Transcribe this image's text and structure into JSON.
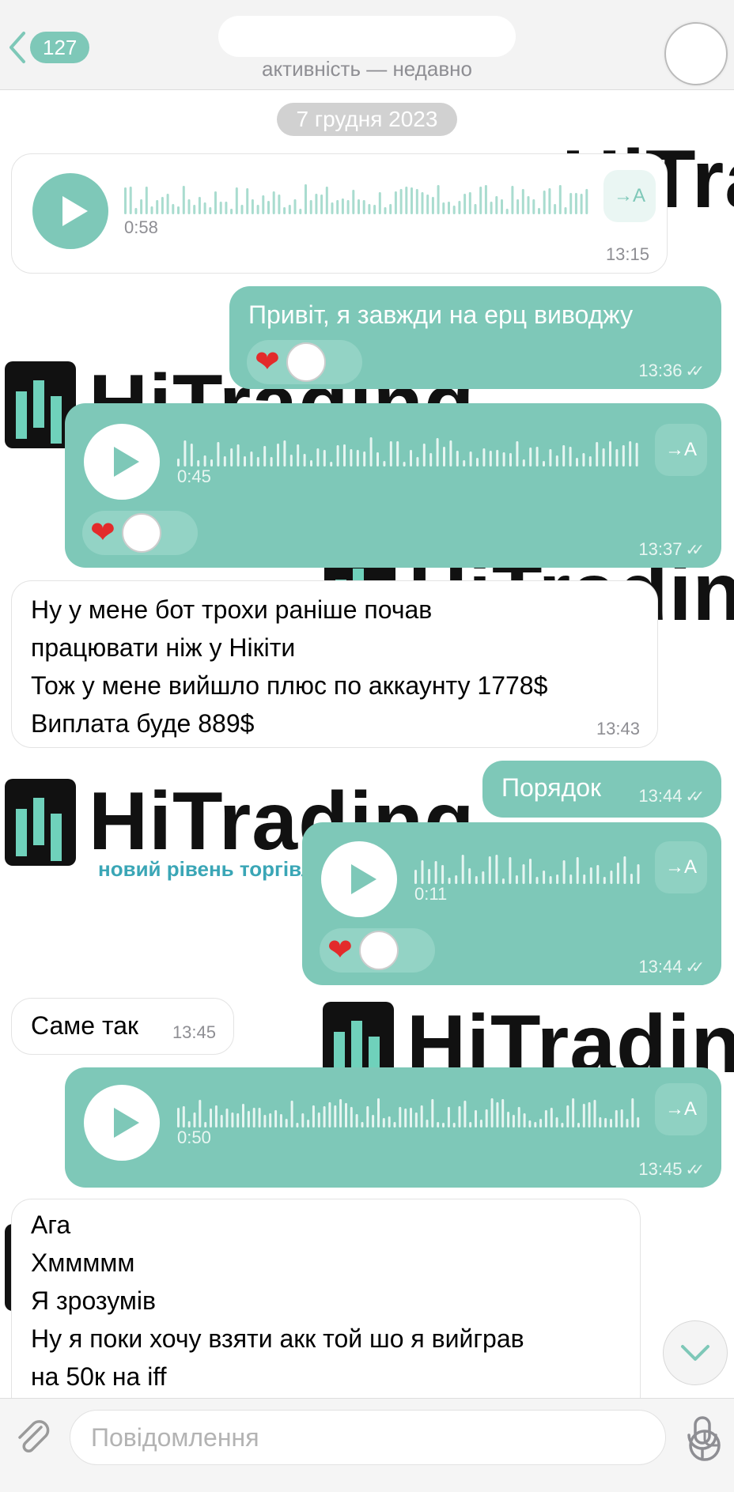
{
  "header": {
    "back_count": "127",
    "status": "активність — недавно"
  },
  "date_label": "7 грудня 2023",
  "watermark": {
    "brand": "HiTrading",
    "tagline": "новий рівень торгівлі"
  },
  "messages": [
    {
      "kind": "voice",
      "direction": "in",
      "duration": "0:58",
      "time": "13:15",
      "translate": "→A"
    },
    {
      "kind": "text",
      "direction": "out",
      "text": "Привіт, я завжди на ерц виводжу",
      "time": "13:36",
      "reaction": "heart"
    },
    {
      "kind": "voice",
      "direction": "out",
      "duration": "0:45",
      "time": "13:37",
      "translate": "→A",
      "reaction": "heart"
    },
    {
      "kind": "text",
      "direction": "in",
      "lines": [
        "Ну у мене бот трохи раніше почав",
        "працювати ніж у Нікіти",
        "Тож у мене вийшло плюс по аккаунту 1778$",
        "Виплата буде 889$"
      ],
      "time": "13:43"
    },
    {
      "kind": "text",
      "direction": "out",
      "text": "Порядок",
      "time": "13:44"
    },
    {
      "kind": "voice",
      "direction": "out",
      "duration": "0:11",
      "time": "13:44",
      "translate": "→A",
      "reaction": "heart"
    },
    {
      "kind": "text",
      "direction": "in",
      "text": "Саме так",
      "time": "13:45"
    },
    {
      "kind": "voice",
      "direction": "out",
      "duration": "0:50",
      "time": "13:45",
      "translate": "→A"
    },
    {
      "kind": "text",
      "direction": "in",
      "lines": [
        "Ага",
        "Хммммм",
        "Я зрозумів",
        "Ну я поки хочу взяти акк той шо я вийграв",
        "на 50к на iff"
      ]
    }
  ],
  "composer": {
    "placeholder": "Повідомлення"
  },
  "colors": {
    "accent": "#7ec8b8",
    "heart": "#e32b2b"
  },
  "icons": {
    "back": "chevron-left-icon",
    "attach": "paperclip-icon",
    "sticker": "sticker-icon",
    "mic": "microphone-icon",
    "scroll": "chevron-down-icon"
  }
}
